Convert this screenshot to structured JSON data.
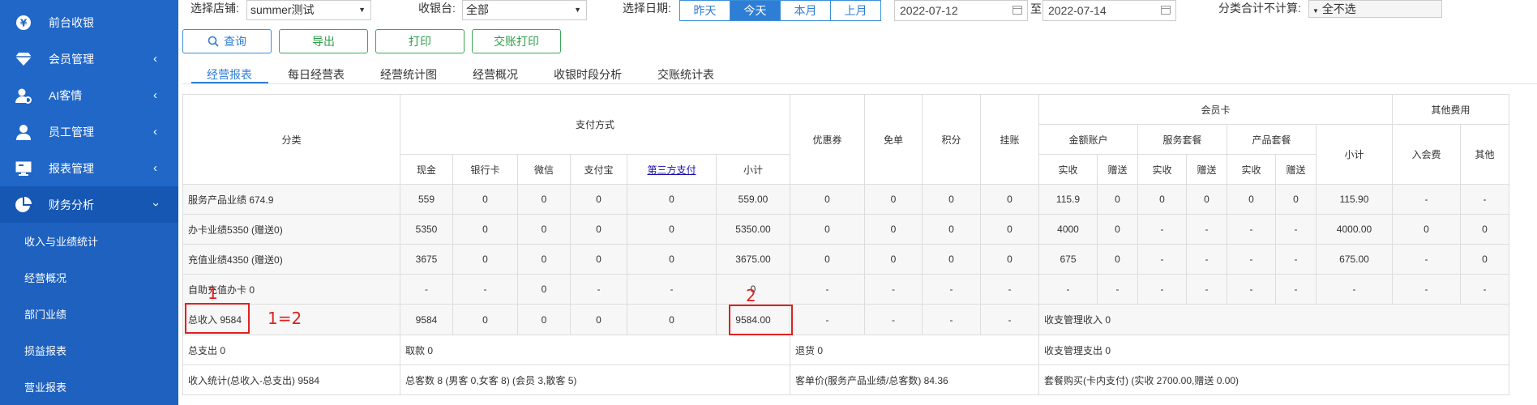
{
  "sidebar": {
    "items": [
      {
        "label": "前台收银",
        "icon": "yen-icon",
        "has_chevron": false
      },
      {
        "label": "会员管理",
        "icon": "diamond-icon",
        "has_chevron": true
      },
      {
        "label": "AI客情",
        "icon": "user-gear-icon",
        "has_chevron": true
      },
      {
        "label": "员工管理",
        "icon": "person-icon",
        "has_chevron": true
      },
      {
        "label": "报表管理",
        "icon": "monitor-icon",
        "has_chevron": true
      },
      {
        "label": "财务分析",
        "icon": "pie-chart-icon",
        "has_chevron": true
      }
    ],
    "submenu": [
      "收入与业绩统计",
      "经营概况",
      "部门业绩",
      "损益报表",
      "营业报表"
    ],
    "colors": {
      "bg": "#2167c8",
      "active": "#1657b4"
    }
  },
  "filters": {
    "store_label": "选择店铺:",
    "store_value": "summer测试",
    "register_label": "收银台:",
    "register_value": "全部",
    "date_label": "选择日期:",
    "quick_dates": [
      "昨天",
      "今天",
      "本月",
      "上月"
    ],
    "quick_active": "今天",
    "date_from": "2022-07-12",
    "date_sep": "至",
    "date_to": "2022-07-14",
    "exclude_label": "分类合计不计算:",
    "exclude_value": "全不选"
  },
  "buttons": {
    "query": "查询",
    "export": "导出",
    "print": "打印",
    "handover_print": "交账打印"
  },
  "tabs": [
    "经营报表",
    "每日经营表",
    "经营统计图",
    "经营概况",
    "收银时段分析",
    "交账统计表"
  ],
  "tab_active": "经营报表",
  "table": {
    "h_category": "分类",
    "h_payment": "支付方式",
    "pay_cols": [
      "现金",
      "银行卡",
      "微信",
      "支付宝",
      "第三方支付",
      "小计"
    ],
    "h_coupon": "优惠券",
    "h_free": "免单",
    "h_points": "积分",
    "h_credit": "挂账",
    "h_member": "会员卡",
    "h_amount": "金额账户",
    "h_service": "服务套餐",
    "h_product": "产品套餐",
    "h_subtotal": "小计",
    "h_actual": "实收",
    "h_gift": "赠送",
    "h_other_fees": "其他费用",
    "h_join_fee": "入会费",
    "h_other": "其他",
    "rows": [
      {
        "name": "服务产品业绩 674.9",
        "cells": [
          "559",
          "0",
          "0",
          "0",
          "0",
          "559.00",
          "0",
          "0",
          "0",
          "0",
          "115.9",
          "0",
          "0",
          "0",
          "0",
          "0",
          "115.90",
          "-",
          "-"
        ]
      },
      {
        "name": "办卡业绩5350 (赠送0)",
        "cells": [
          "5350",
          "0",
          "0",
          "0",
          "0",
          "5350.00",
          "0",
          "0",
          "0",
          "0",
          "4000",
          "0",
          "-",
          "-",
          "-",
          "-",
          "4000.00",
          "0",
          "0"
        ]
      },
      {
        "name": "充值业绩4350 (赠送0)",
        "cells": [
          "3675",
          "0",
          "0",
          "0",
          "0",
          "3675.00",
          "0",
          "0",
          "0",
          "0",
          "675",
          "0",
          "-",
          "-",
          "-",
          "-",
          "675.00",
          "-",
          "0"
        ]
      },
      {
        "name": "自助充值办卡 0",
        "cells": [
          "-",
          "-",
          "0",
          "-",
          "-",
          "0",
          "-",
          "-",
          "-",
          "-",
          "-",
          "-",
          "-",
          "-",
          "-",
          "-",
          "-",
          "-",
          "-"
        ]
      }
    ],
    "total_row": {
      "name": "总收入 9584",
      "cells": [
        "9584",
        "0",
        "0",
        "0",
        "0",
        "9584.00",
        "-",
        "-",
        "-",
        "-"
      ],
      "member_note": "收支管理收入 0"
    },
    "summary_rows": [
      {
        "c1": "总支出 0",
        "c2": "取款 0",
        "c3": "退货 0",
        "c4": "收支管理支出 0"
      },
      {
        "c1": "收入统计(总收入-总支出) 9584",
        "c2": "总客数 8 (男客 0,女客 8) (会员 3,散客 5)",
        "c3": "客单价(服务产品业绩/总客数) 84.36",
        "c4": "套餐购买(卡内支付) (实收 2700.00,赠送 0.00)"
      }
    ]
  },
  "annotations": {
    "label1": "1",
    "label2": "2",
    "equation": "1=2",
    "color": "#e02020"
  }
}
